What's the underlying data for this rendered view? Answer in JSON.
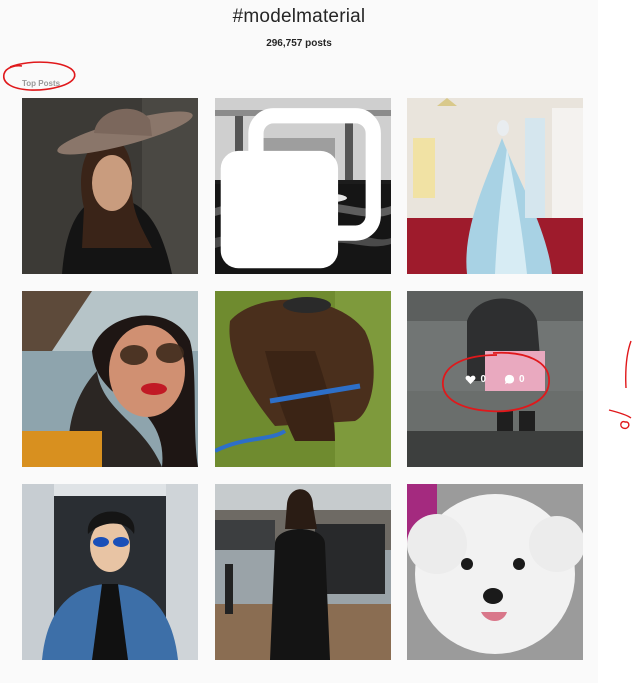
{
  "header": {
    "hashtag": "#modelmaterial",
    "post_count": "296,757 posts"
  },
  "section": {
    "label": "Top Posts"
  },
  "posts": [
    {
      "subject": "woman-in-fedora-hat"
    },
    {
      "subject": "black-and-white-swimmer-in-pool",
      "multiple_photos": true
    },
    {
      "subject": "light-blue-bridal-gown-shop"
    },
    {
      "subject": "woman-with-sunglasses-red-lipstick"
    },
    {
      "subject": "pony-with-blue-halter-on-grass"
    },
    {
      "subject": "person-seated-on-bench",
      "hover": {
        "likes": "0",
        "comments": "0"
      }
    },
    {
      "subject": "man-in-denim-jacket-blue-sunglasses"
    },
    {
      "subject": "man-in-black-coat-on-street"
    },
    {
      "subject": "white-fluffy-dog"
    }
  ],
  "colors": {
    "annotation": "#e0181b",
    "label_gray": "#999999",
    "page_bg": "#fafafa"
  }
}
